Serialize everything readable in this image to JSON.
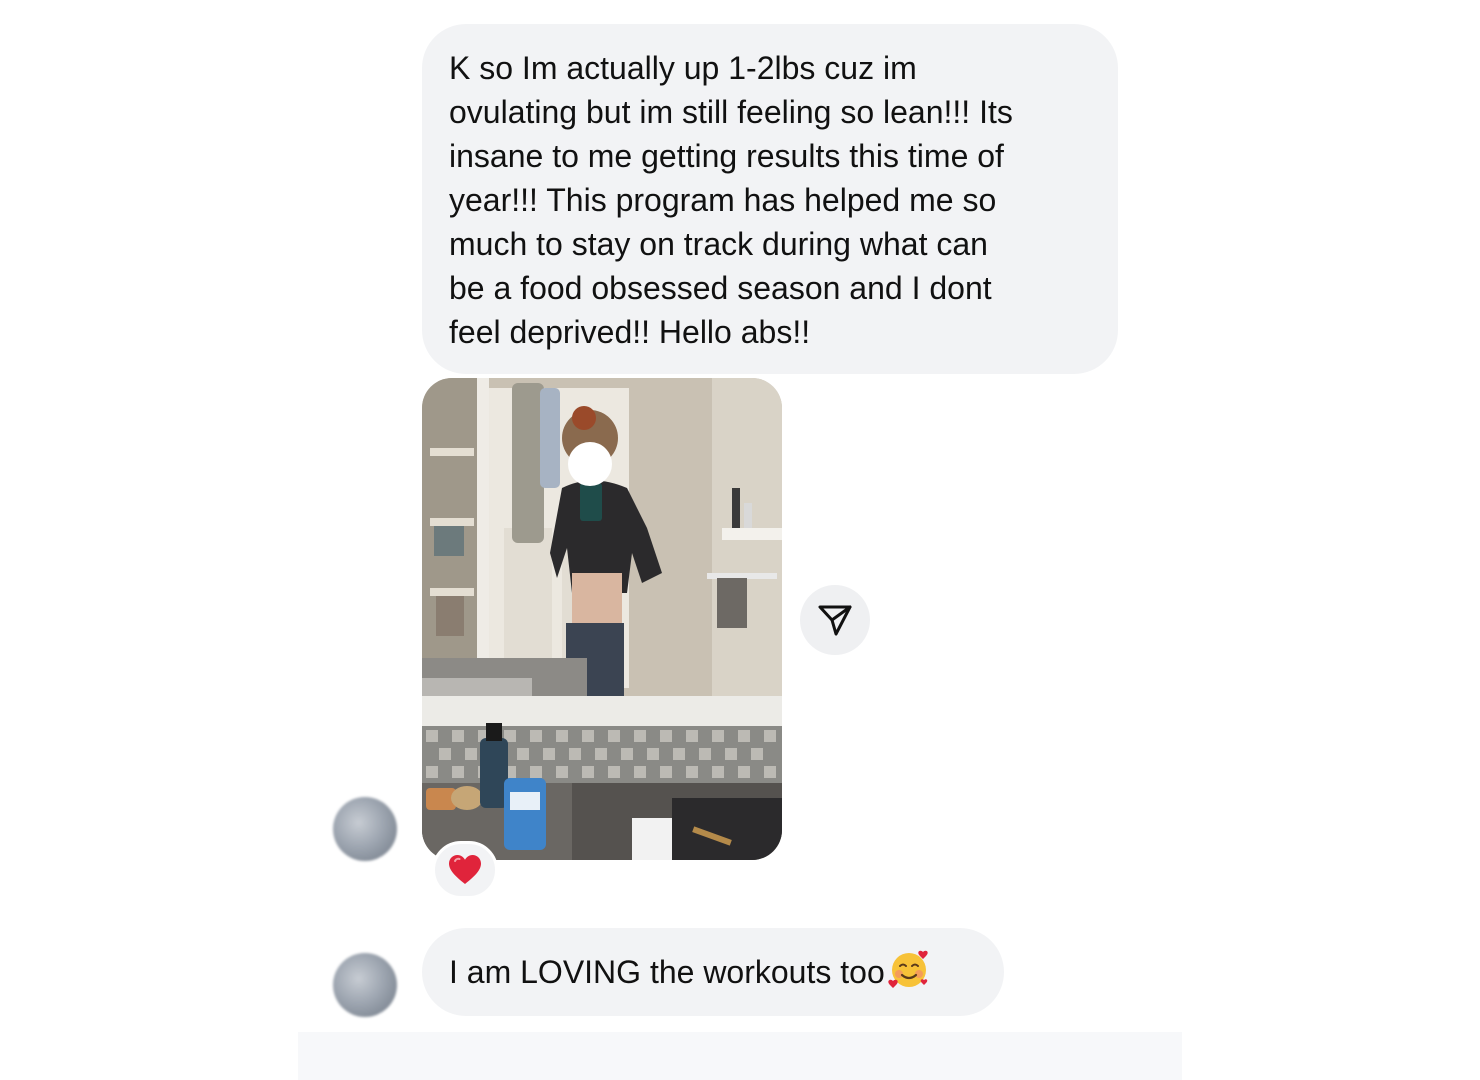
{
  "thread": {
    "messages": [
      {
        "type": "text",
        "lines": [
          "K so Im actually up 1-2lbs cuz im",
          "ovulating but im still feeling so lean!!! Its",
          "insane to me getting results this time of",
          "year!!! This program has helped me so",
          "much to stay on track during what can",
          "be a food obsessed season and I dont",
          "feel deprived!! Hello abs!!"
        ]
      },
      {
        "type": "image",
        "icon": "mirror-selfie-photo",
        "reaction": "red-heart-icon"
      },
      {
        "type": "text",
        "text": "I am LOVING the workouts too",
        "emoji": "smiling-face-with-hearts-icon"
      }
    ],
    "share_icon": "paper-plane-icon"
  },
  "colors": {
    "bubble": "#f2f3f5",
    "text": "#111111",
    "heart": "#e0243b",
    "background": "#ffffff"
  }
}
